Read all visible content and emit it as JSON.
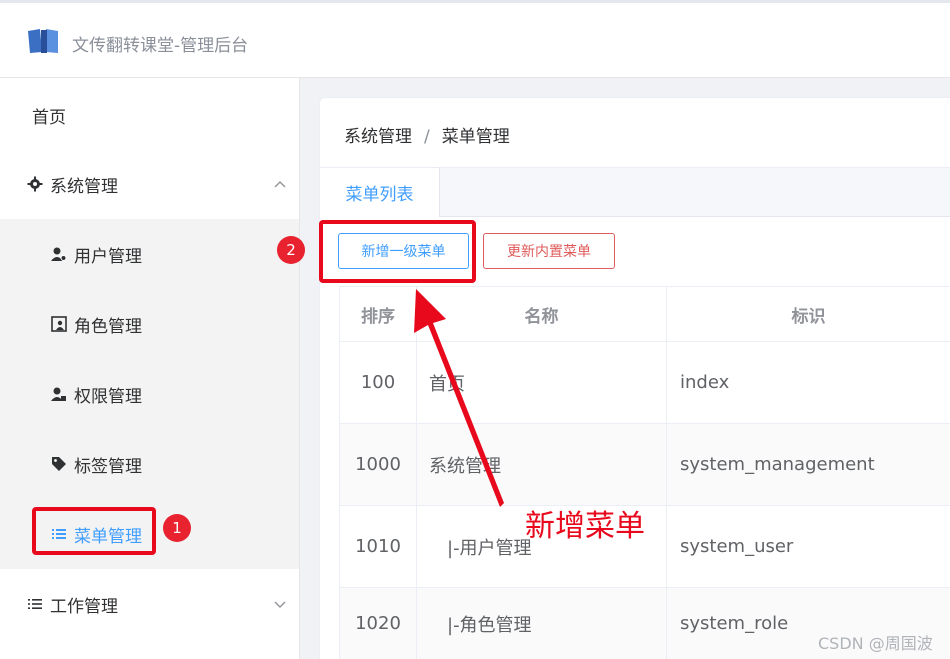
{
  "header": {
    "title": "文传翻转课堂-管理后台"
  },
  "sidebar": {
    "home": "首页",
    "system": "系统管理",
    "items": [
      {
        "label": "用户管理",
        "icon": "user-gear-icon"
      },
      {
        "label": "角色管理",
        "icon": "role-card-icon"
      },
      {
        "label": "权限管理",
        "icon": "user-lock-icon"
      },
      {
        "label": "标签管理",
        "icon": "tag-icon"
      },
      {
        "label": "菜单管理",
        "icon": "list-icon"
      }
    ],
    "work": "工作管理"
  },
  "breadcrumb": {
    "parent": "系统管理",
    "separator": "/",
    "current": "菜单管理"
  },
  "tabs": [
    {
      "label": "菜单列表"
    }
  ],
  "toolbar": {
    "add_label": "新增一级菜单",
    "refresh_label": "更新内置菜单"
  },
  "table": {
    "columns": [
      "排序",
      "名称",
      "标识"
    ],
    "rows": [
      {
        "order": "100",
        "name": "首页",
        "key": "index"
      },
      {
        "order": "1000",
        "name": "系统管理",
        "key": "system_management"
      },
      {
        "order": "1010",
        "name": "|-用户管理",
        "key": "system_user"
      },
      {
        "order": "1020",
        "name": "|-角色管理",
        "key": "system_role"
      }
    ]
  },
  "annotations": {
    "badge1": "1",
    "badge2": "2",
    "callout": "新增菜单"
  },
  "watermark": "CSDN @周国波",
  "colors": {
    "accent": "#409eff",
    "danger": "#e05b5b",
    "annotation": "#e8091c"
  }
}
